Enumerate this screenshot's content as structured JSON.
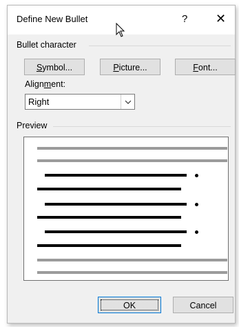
{
  "dialog": {
    "title": "Define New Bullet",
    "help_label": "?",
    "close_label": "✕"
  },
  "bullet_character": {
    "group_label": "Bullet character",
    "symbol": {
      "before": "",
      "access": "S",
      "after": "ymbol..."
    },
    "picture": {
      "before": "",
      "access": "P",
      "after": "icture..."
    },
    "font": {
      "before": "",
      "access": "F",
      "after": "ont..."
    },
    "alignment_label": {
      "before": "Align",
      "access": "m",
      "after": "ent:"
    },
    "alignment_value": "Right"
  },
  "preview": {
    "group_label": "Preview"
  },
  "footer": {
    "ok_label": "OK",
    "cancel_label": "Cancel"
  },
  "icons": [
    "mouse-pointer-icon",
    "chevron-down-icon",
    "bullet-dot-icon"
  ]
}
